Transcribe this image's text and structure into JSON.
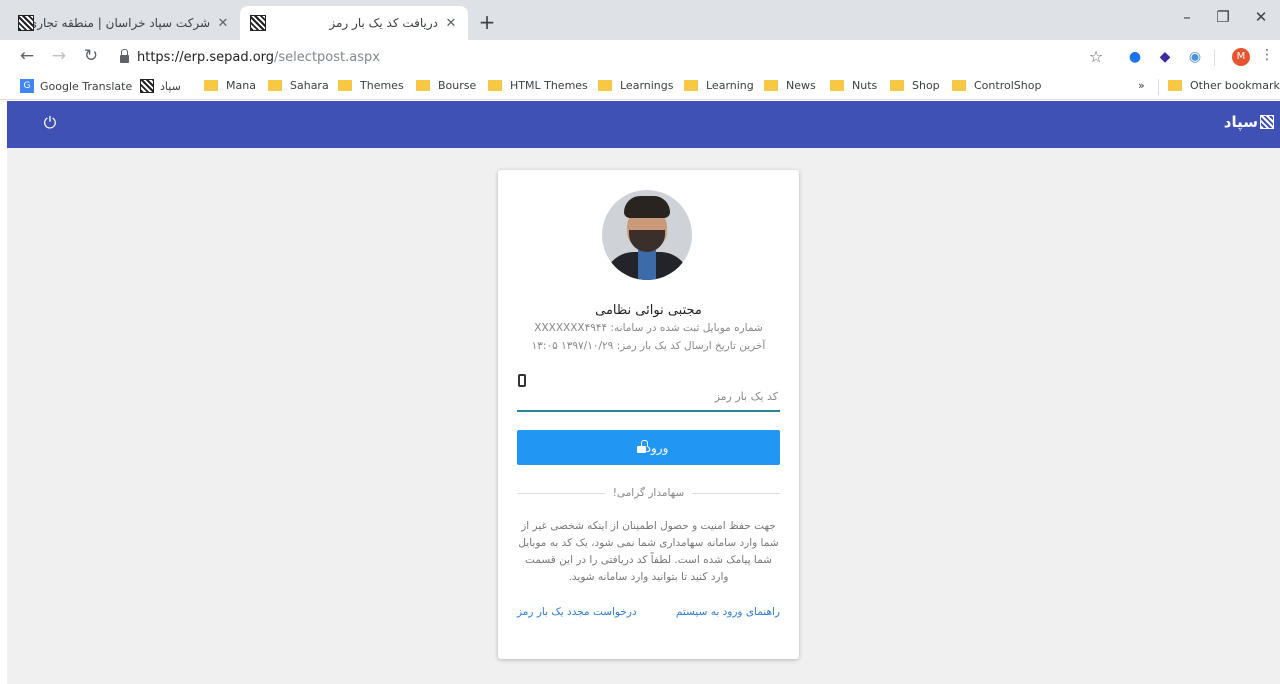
{
  "browser": {
    "tabs": [
      {
        "title": "شرکت سپاد خراسان | منطقه تجاری",
        "active": false
      },
      {
        "title": "دریافت کد یک بار رمز",
        "active": true
      }
    ],
    "url_host": "https://erp.sepad.org",
    "url_path": "/selectpost.aspx",
    "profile_initial": "M",
    "bookmarks": [
      {
        "label": "Google Translate",
        "icon": "google-translate-icon"
      },
      {
        "label": "سپاد",
        "icon": "sepad-icon"
      },
      {
        "label": "Mana",
        "icon": "folder-icon"
      },
      {
        "label": "Sahara",
        "icon": "folder-icon"
      },
      {
        "label": "Themes",
        "icon": "folder-icon"
      },
      {
        "label": "Bourse",
        "icon": "folder-icon"
      },
      {
        "label": "HTML Themes",
        "icon": "folder-icon"
      },
      {
        "label": "Learnings",
        "icon": "folder-icon"
      },
      {
        "label": "Learning",
        "icon": "folder-icon"
      },
      {
        "label": "News",
        "icon": "folder-icon"
      },
      {
        "label": "Nuts",
        "icon": "folder-icon"
      },
      {
        "label": "Shop",
        "icon": "folder-icon"
      },
      {
        "label": "ControlShop",
        "icon": "folder-icon"
      }
    ],
    "overflow_label": "»",
    "other_bookmarks": "Other bookmarks"
  },
  "app": {
    "brand": "سپاد",
    "header_color": "#3f51b5"
  },
  "card": {
    "user_name": "مجتبی نوائی نظامی",
    "mobile_line": "شماره موبایل ثبت شده در سامانه: XXXXXXX۴۹۴۴",
    "last_sent_line": "آخرین تاریخ ارسال کد یک بار رمز: ۱۳۹۷/۱۰/۲۹ ۱۳:۰۵",
    "otp_placeholder": "کد یک بار رمز",
    "otp_value": "",
    "login_label": "ورود",
    "login_color": "#2196f3",
    "divider_text": "سهامدار گرامی!",
    "info_text": "جهت حفظ امنیت و حصول اطمینان از اینکه شخصی غیر از شما وارد سامانه سهامداری شما نمی شود، یک کد به موبایل شما پیامک شده است. لطفاً کد دریافتی را در این قسمت وارد کنید تا بتوانید وارد سامانه شوید.",
    "help_link": "راهنمای ورود به سیستم",
    "resend_link": "درخواست مجدد یک بار رمز"
  }
}
